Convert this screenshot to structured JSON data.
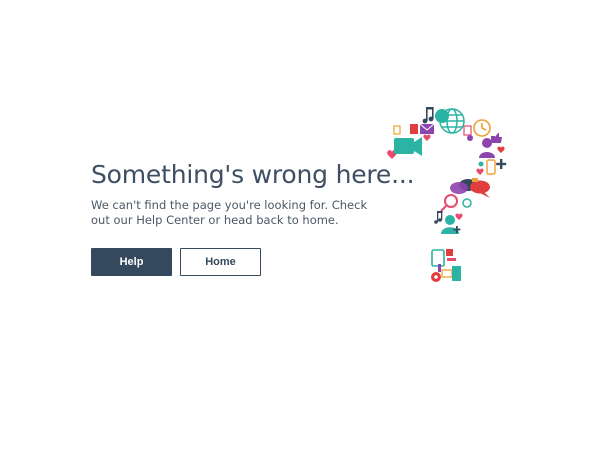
{
  "error_page": {
    "title": "Something's wrong here...",
    "message": "We can't find the page you're looking for. Check out our Help Center or head back to home.",
    "buttons": {
      "help_label": "Help",
      "home_label": "Home"
    },
    "illustration": {
      "icon": "question-mark-icon",
      "made_of": [
        "music-note-icon",
        "mail-icon",
        "globe-icon",
        "clock-icon",
        "camera-icon",
        "chat-bubble-icon",
        "phone-icon",
        "person-icon",
        "search-icon",
        "tablet-icon",
        "gear-icon",
        "heart-icon",
        "thumbs-up-icon",
        "plus-icon"
      ]
    },
    "colors": {
      "primary": "#34495e",
      "text": "#3f4f63",
      "teal": "#2bb3a3",
      "purple": "#8e44ad",
      "pink": "#e74c6f",
      "orange": "#f0a030",
      "red": "#e03e3e"
    }
  }
}
